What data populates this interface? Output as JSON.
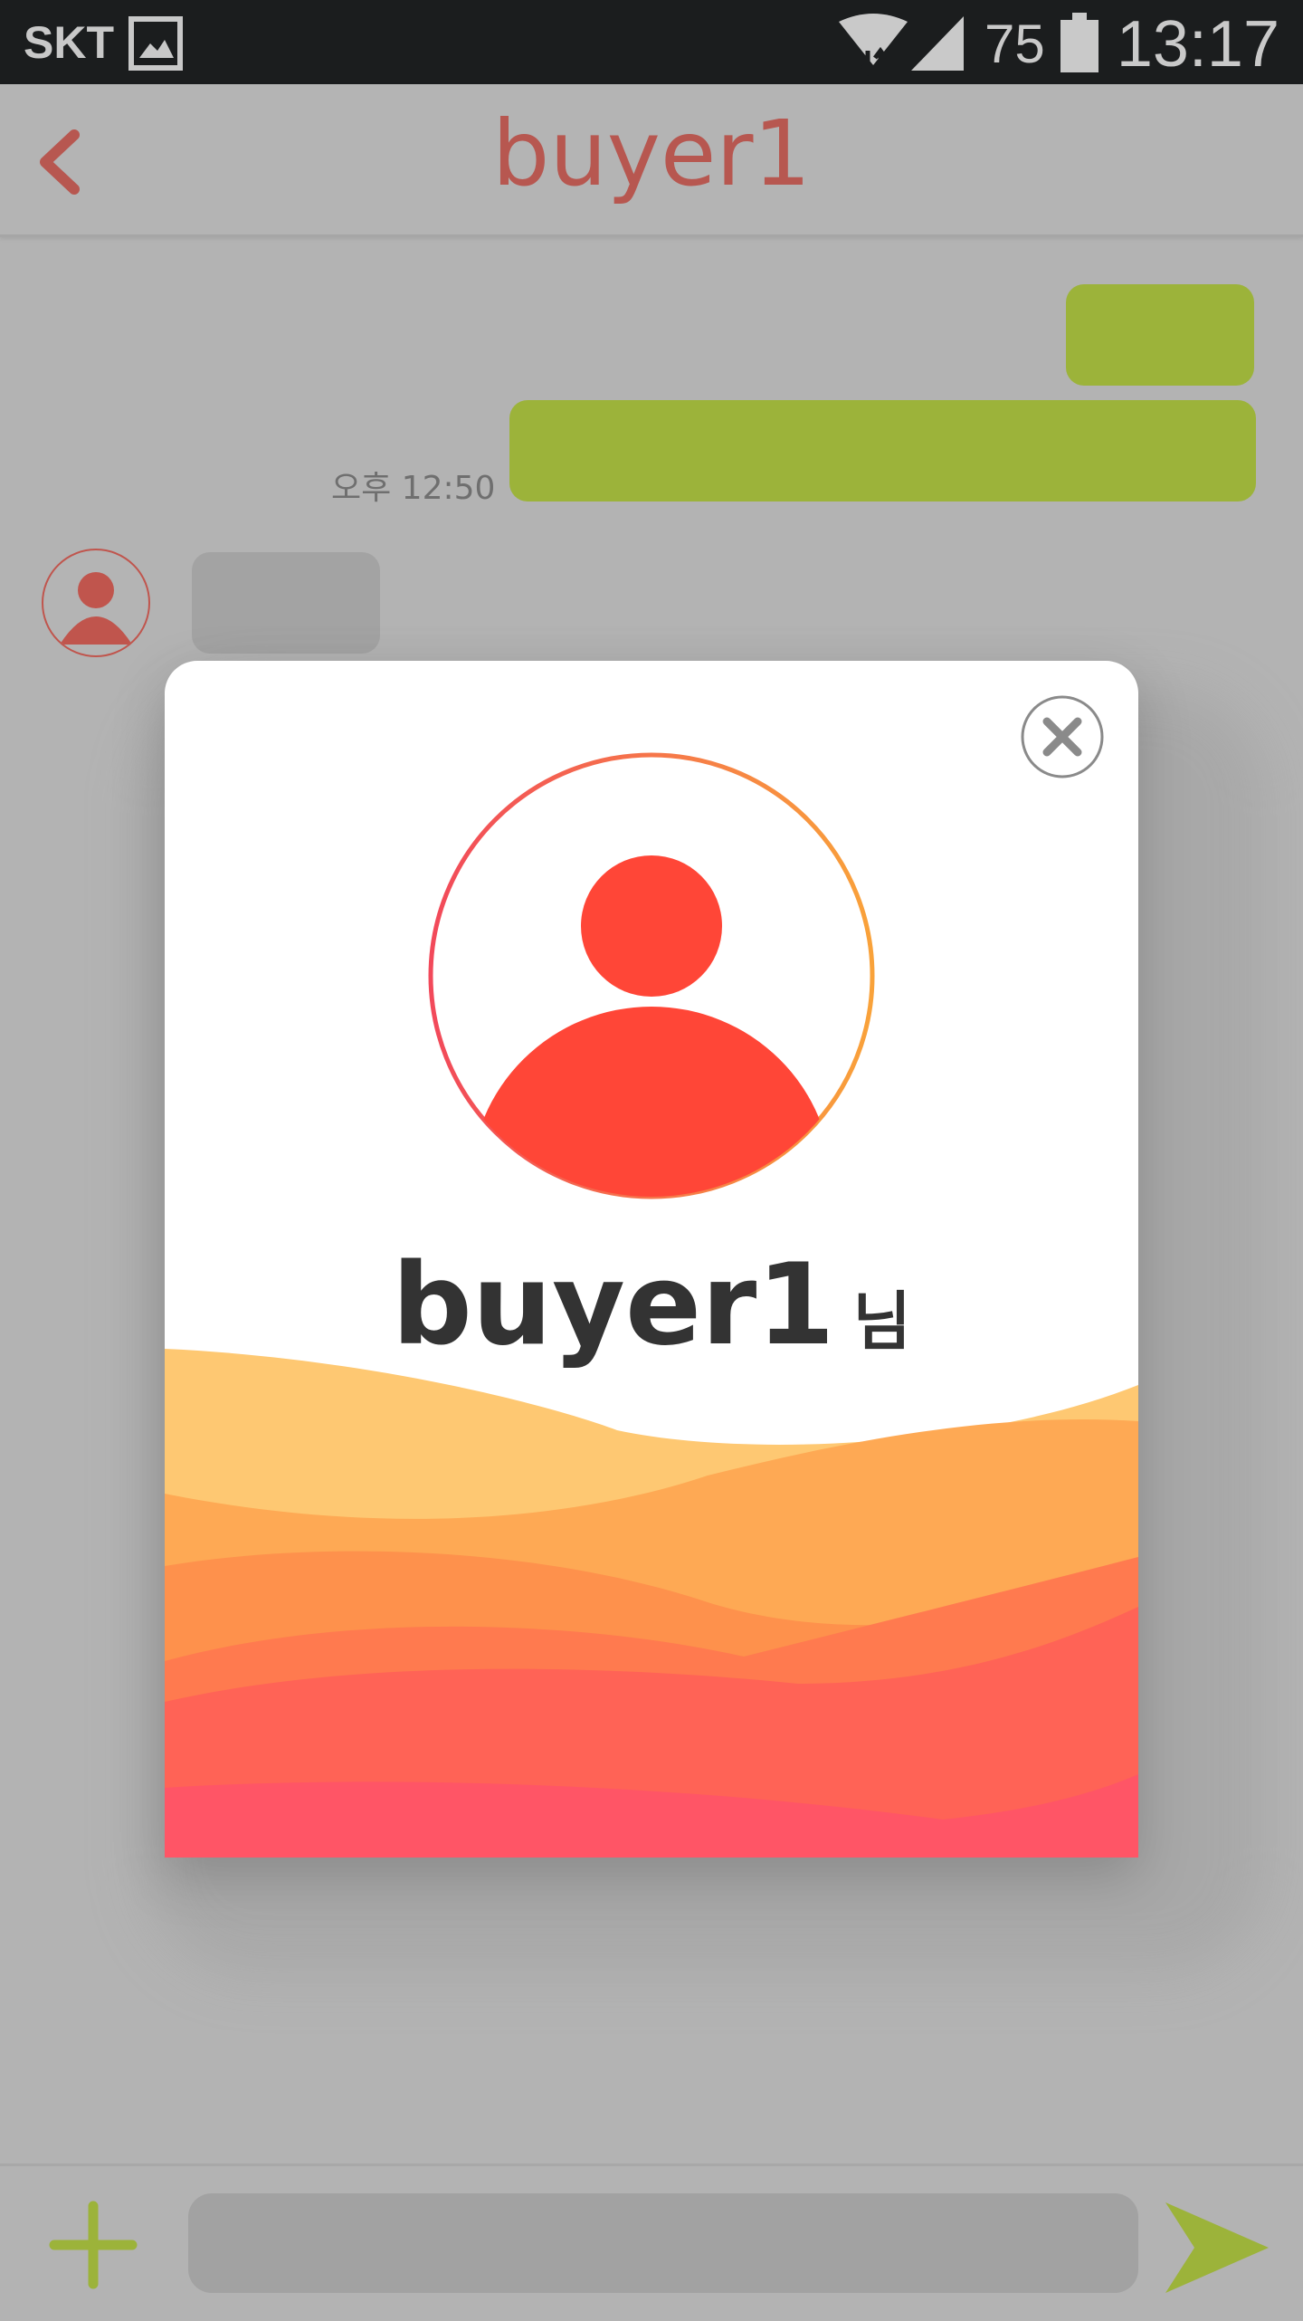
{
  "status_bar": {
    "carrier": "SKT",
    "battery_level": "75",
    "time": "13:17"
  },
  "header": {
    "title": "buyer1"
  },
  "messages": {
    "time_label": "오후 12:50"
  },
  "profile_popup": {
    "name": "buyer1",
    "honorific": "님"
  },
  "composer": {
    "input_value": ""
  },
  "colors": {
    "accent_red": "#ff4637",
    "outgoing_bubble": "#9cb33a",
    "title_red": "#b75750",
    "plus_green": "#9cb33a"
  }
}
